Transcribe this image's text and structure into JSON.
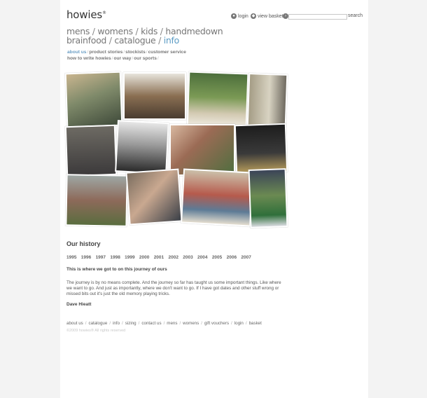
{
  "brand": {
    "name": "howies",
    "mark": "®"
  },
  "topbar": {
    "login_label": "login",
    "basket_label": "view basket",
    "search_label": "search",
    "search_placeholder": ""
  },
  "main_nav": {
    "row1": [
      "mens",
      "womens",
      "kids",
      "handmedown"
    ],
    "row2": [
      "brainfood",
      "catalogue",
      "info"
    ],
    "separator": "/",
    "active": "info"
  },
  "sub_nav": {
    "row1": [
      "about us",
      "product stories",
      "stockists",
      "customer service"
    ],
    "row2": [
      "how to write howies",
      "our way",
      "our sports"
    ],
    "active": "about us"
  },
  "history": {
    "title": "Our history",
    "years": [
      "1995",
      "1996",
      "1997",
      "1998",
      "1999",
      "2000",
      "2001",
      "2002",
      "2003",
      "2004",
      "2005",
      "2006",
      "2007"
    ],
    "subheading": "This is where we got to on this journey of ours",
    "paragraph": "The journey is by no means complete. And the journey so far has taught us some important things. Like where we want to go. And just as importantly, where we don't want to go. If I have got dates and other stuff wrong or missed bits out it's just the old memory playing tricks.",
    "author": "Dave Hieatt"
  },
  "footer": {
    "links": [
      "about us",
      "catalogue",
      "info",
      "sizing",
      "contact us",
      "mens",
      "womens",
      "gift vouchers",
      "login",
      "basket"
    ],
    "copyright": "©2009 howies® All rights reserved"
  },
  "colors": {
    "accent": "#5b9bc4",
    "background": "#f3f3f3",
    "panel": "#ffffff"
  },
  "icons": {
    "login": "user-icon",
    "basket": "basket-icon",
    "search": "search-icon"
  }
}
